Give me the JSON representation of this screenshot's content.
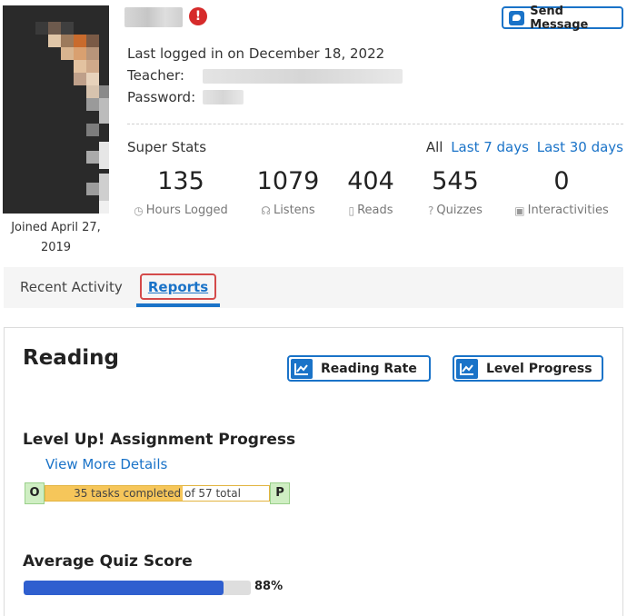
{
  "profile": {
    "joined": "Joined April 27, 2019",
    "last_login": "Last logged in on December 18, 2022",
    "teacher_label": "Teacher:",
    "password_label": "Password:",
    "alert_icon": "exclamation-icon",
    "send_message": "Send Message"
  },
  "super_stats": {
    "title": "Super Stats",
    "filters": {
      "all": "All",
      "last7": "Last 7 days",
      "last30": "Last 30 days"
    },
    "stats": [
      {
        "value": "135",
        "label": "Hours Logged",
        "icon": "clock-icon"
      },
      {
        "value": "1079",
        "label": "Listens",
        "icon": "headphones-icon"
      },
      {
        "value": "404",
        "label": "Reads",
        "icon": "book-icon"
      },
      {
        "value": "545",
        "label": "Quizzes",
        "icon": "question-icon"
      },
      {
        "value": "0",
        "label": "Interactivities",
        "icon": "interactive-icon"
      }
    ]
  },
  "tabs": {
    "recent": "Recent Activity",
    "reports": "Reports",
    "active": "Reports"
  },
  "reading": {
    "title": "Reading",
    "buttons": {
      "rate": "Reading Rate",
      "level": "Level Progress"
    },
    "level_up": {
      "title": "Level Up! Assignment Progress",
      "view_more": "View More Details",
      "from_level": "O",
      "to_level": "P",
      "completed_text": "35 tasks completed",
      "total_text": "of 57 total",
      "completed": 35,
      "total": 57
    },
    "quiz": {
      "title": "Average Quiz Score",
      "percent_text": "88%",
      "percent": 88
    }
  },
  "colors": {
    "accent": "#1a73c8",
    "alert": "#d62b2b",
    "progress": "#f6c65a",
    "quiz": "#2f5fcf"
  }
}
